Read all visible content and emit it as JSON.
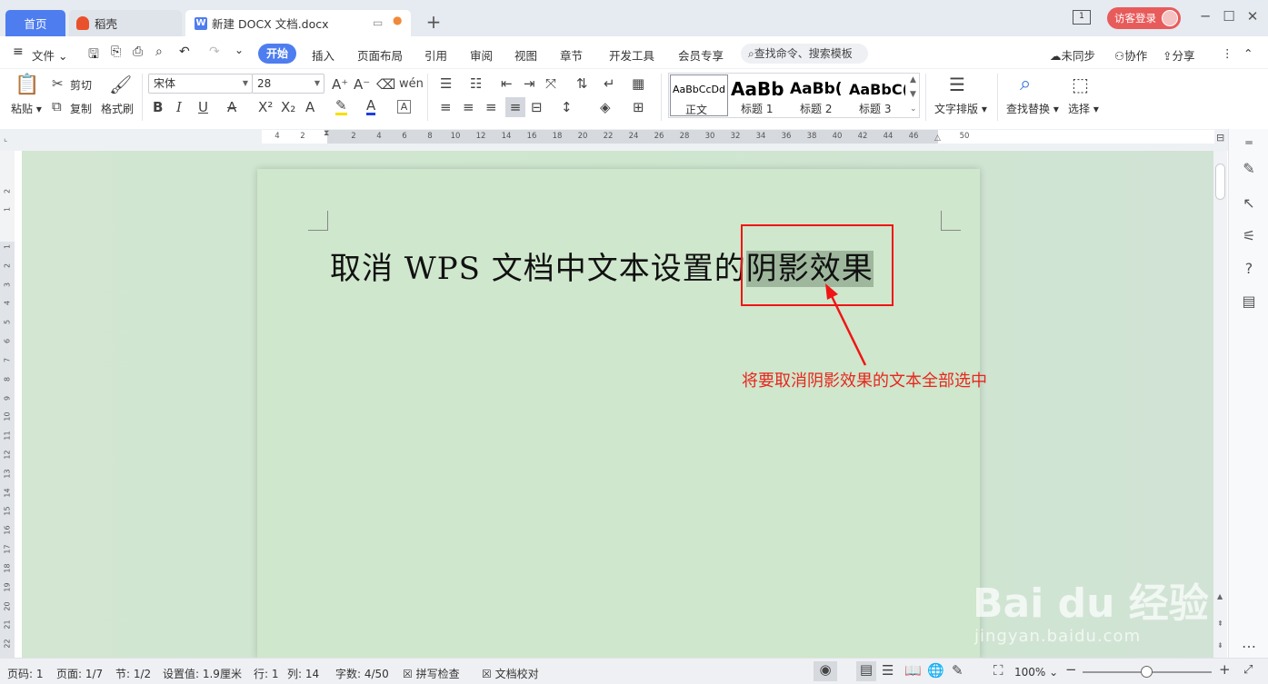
{
  "titlebar": {
    "tabs": [
      {
        "label": "首页"
      },
      {
        "label": "稻壳"
      },
      {
        "label": "新建 DOCX 文档.docx"
      }
    ],
    "new_tab": "+",
    "login_label": "访客登录",
    "page_badge": "1"
  },
  "menubar": {
    "file_label": "文件",
    "items": [
      "开始",
      "插入",
      "页面布局",
      "引用",
      "审阅",
      "视图",
      "章节",
      "开发工具",
      "会员专享"
    ],
    "search_placeholder": "查找命令、搜索模板",
    "right": [
      "未同步",
      "协作",
      "分享"
    ]
  },
  "ribbon": {
    "paste": "粘贴",
    "cut": "剪切",
    "copy": "复制",
    "format_painter": "格式刷",
    "font_name": "宋体",
    "font_size": "28",
    "styles": [
      {
        "preview": "AaBbCcDd",
        "label": "正文"
      },
      {
        "preview": "AaBb",
        "label": "标题 1"
      },
      {
        "preview": "AaBb(",
        "label": "标题 2"
      },
      {
        "preview": "AaBbC(",
        "label": "标题 3"
      }
    ],
    "text_layout": "文字排版",
    "find_replace": "查找替换",
    "select": "选择"
  },
  "ruler": {
    "h_ticks": [
      "4",
      "2",
      "2",
      "4",
      "6",
      "8",
      "10",
      "12",
      "14",
      "16",
      "18",
      "20",
      "22",
      "24",
      "26",
      "28",
      "30",
      "32",
      "34",
      "36",
      "38",
      "40",
      "42",
      "44",
      "46",
      "50"
    ],
    "v_ticks": [
      "2",
      "1",
      "1",
      "2",
      "3",
      "4",
      "5",
      "6",
      "7",
      "8",
      "9",
      "10",
      "11",
      "12",
      "13",
      "14",
      "15",
      "16",
      "17",
      "18",
      "19",
      "20",
      "21",
      "22"
    ]
  },
  "document": {
    "text_normal": "取消 WPS 文档中文本设置的",
    "text_selected": "阴影效果"
  },
  "annotation": "将要取消阴影效果的文本全部选中",
  "statusbar": {
    "page_code": "页码: 1",
    "page": "页面: 1/7",
    "section": "节: 1/2",
    "setting": "设置值: 1.9厘米",
    "line": "行: 1",
    "column": "列: 14",
    "words": "字数: 4/50",
    "spellcheck": "拼写检查",
    "proofread": "文档校对",
    "zoom": "100%"
  },
  "watermark": {
    "logo": "Bai du 经验",
    "url": "jingyan.baidu.com"
  },
  "colors": {
    "accent": "#4e7df0",
    "login": "#e85b5b",
    "canvas": "#cfe7cc",
    "annotation": "#e8261e"
  }
}
